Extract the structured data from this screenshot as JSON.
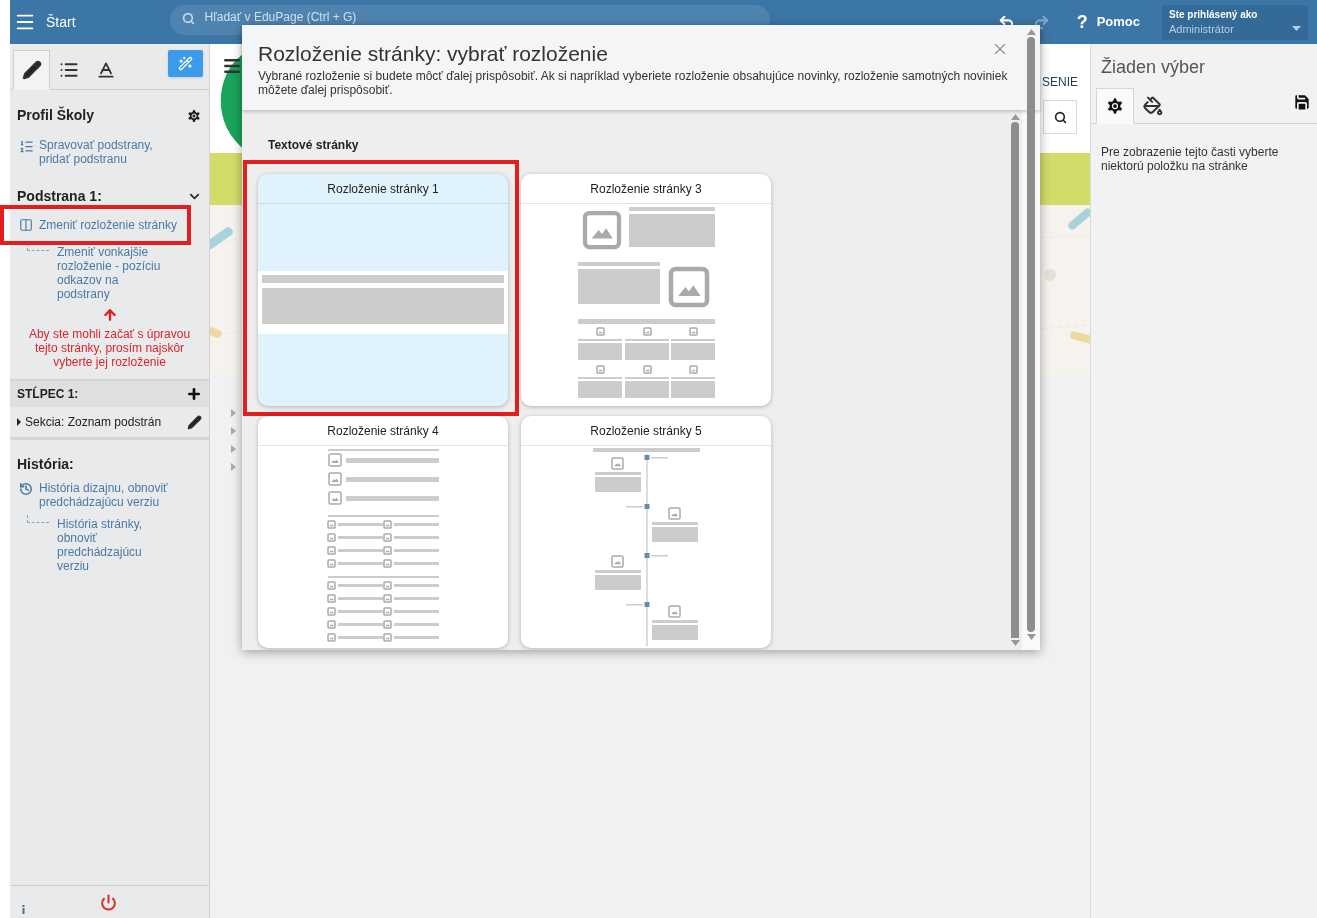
{
  "topbar": {
    "menu_label": "Štart",
    "search_placeholder": "Hľadať v EduPage (Ctrl + G)",
    "history_buttons": [
      {
        "kind": "undo",
        "disabled": false
      },
      {
        "kind": "redo",
        "disabled": true
      }
    ],
    "help_icon": "?",
    "help_label": "Pomoc",
    "user_caption": "Ste prihlásený ako",
    "user_name": "Administrátor"
  },
  "left_panel": {
    "tabs": [
      {
        "kind": "pencil",
        "selected": true
      },
      {
        "kind": "list",
        "selected": false
      },
      {
        "kind": "text",
        "selected": false
      }
    ],
    "profile": {
      "title": "Profil Školy",
      "link": "Spravovať podstrany, pridať podstranu"
    },
    "subpage": {
      "title": "Podstrana 1:",
      "expanded": true,
      "link": "Zmeniť rozloženie stránky",
      "highlighted": true,
      "child_link": "Zmeniť vonkajšie rozloženie - pozíciu odkazov na podstrany",
      "warning": "Aby ste mohli začať s úpravou tejto stránky, prosím najskôr vyberte jej rozloženie"
    },
    "column": {
      "title": "STĹPEC 1:",
      "section": "Sekcia: Zoznam podstrán"
    },
    "history": {
      "title": "História:",
      "link": "História dizajnu, obnoviť predchádzajúcu verziu",
      "child_link": "História stránky, obnoviť predchádzajúcu verziu"
    }
  },
  "page_behind": {
    "menu_text": "SENIE"
  },
  "dialog": {
    "title": "Rozloženie stránky: vybrať rozloženie",
    "description": "Vybrané rozloženie si budete môcť ďalej prispôsobiť. Ak si napríklad vyberiete rozloženie obsahujúce novinky, rozloženie samotných noviniek môžete ďalej prispôsobiť.",
    "group": "Textové stránky",
    "layouts": [
      {
        "label": "Rozloženie stránky 1",
        "kind": "banner",
        "selected": true,
        "highlighted": true
      },
      {
        "label": "Rozloženie stránky 3",
        "kind": "mixed",
        "selected": false,
        "highlighted": false
      },
      {
        "label": "Rozloženie stránky 4",
        "kind": "list",
        "selected": false,
        "highlighted": false
      },
      {
        "label": "Rozloženie stránky 5",
        "kind": "timeline",
        "selected": false,
        "highlighted": false
      }
    ]
  },
  "right_panel": {
    "title": "Žiaden výber",
    "tabs": [
      {
        "kind": "settings",
        "selected": true
      },
      {
        "kind": "fill",
        "selected": false
      }
    ],
    "message": "Pre zobrazenie tejto časti vyberte niektorú položku na stránke"
  }
}
